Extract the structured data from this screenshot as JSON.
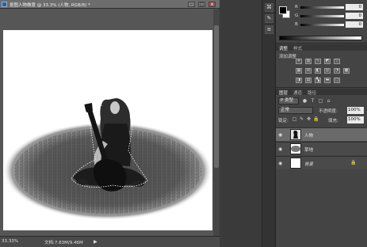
{
  "document": {
    "title": "抠图人物做景 @ 33.3% (人物, RGB/8) *",
    "zoom": "33.33%",
    "doc_size": "文档:7.83M/9.46M",
    "status_arrow": "▶"
  },
  "window_buttons": {
    "minimize": "–",
    "maximize": "□",
    "close": "x"
  },
  "color_panel": {
    "fg_color": "#000000",
    "bg_color": "#ffffff",
    "sliders": [
      {
        "label": "R",
        "value": "0"
      },
      {
        "label": "G",
        "value": "0"
      },
      {
        "label": "B",
        "value": "0"
      }
    ]
  },
  "adjustments_panel": {
    "tabs": [
      "调整",
      "样式"
    ],
    "add_label": "添加调整",
    "icons": [
      "brightness-icon",
      "levels-icon",
      "curves-icon",
      "exposure-icon",
      "vibrance-icon",
      "hue-icon",
      "color-balance-icon",
      "bw-icon",
      "photo-filter-icon",
      "channel-mixer-icon",
      "lookup-icon",
      "invert-icon",
      "posterize-icon",
      "threshold-icon",
      "gradient-map-icon",
      "selective-color-icon"
    ]
  },
  "layers_panel": {
    "tabs": [
      "图层",
      "通道",
      "路径"
    ],
    "kind": "P 类型",
    "kind_icons": [
      "●",
      "T",
      "□",
      "⌂"
    ],
    "blend_mode": "正常",
    "opacity_label": "不透明度:",
    "opacity": "100%",
    "lock_label": "锁定:",
    "lock_icons": [
      "□",
      "✎",
      "✥",
      "🔒"
    ],
    "fill_label": "填充:",
    "fill": "100%",
    "layers": [
      {
        "name": "人物",
        "selected": true,
        "locked": false
      },
      {
        "name": "草地",
        "selected": false,
        "locked": false
      },
      {
        "name": "背景",
        "selected": false,
        "locked": true
      }
    ]
  }
}
